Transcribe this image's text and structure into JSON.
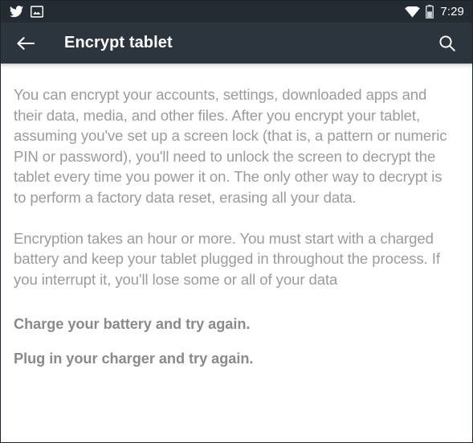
{
  "status_bar": {
    "left_icons": [
      {
        "name": "twitter-icon",
        "label": "Twitter"
      },
      {
        "name": "image-icon",
        "label": "Screenshot captured"
      }
    ],
    "right_icons": [
      {
        "name": "wifi-icon",
        "label": "Wi-Fi"
      },
      {
        "name": "battery-icon",
        "label": "Battery"
      }
    ],
    "clock": "7:29",
    "background_color": "#242b32"
  },
  "app_bar": {
    "back_label": "Navigate up",
    "title": "Encrypt tablet",
    "search_label": "Search",
    "background_color": "#2c353d",
    "title_color": "#ffffff"
  },
  "content": {
    "paragraphs": [
      "You can encrypt your accounts, settings, downloaded apps and their data, media, and other files. After you encrypt your tablet, assuming you've set up a screen lock (that is, a pattern or numeric PIN or password), you'll need to unlock the screen to decrypt the tablet every time you power it on. The only other way to decrypt is to perform a factory data reset, erasing all your data.",
      "Encryption takes an hour or more. You must start with a charged battery and keep your tablet plugged in throughout the process. If you interrupt it, you'll lose some or all of your data"
    ],
    "warnings": [
      "Charge your battery and try again.",
      "Plug in your charger and try again."
    ],
    "body_text_color": "#9b9b9b",
    "warning_text_color": "#8a8a8a",
    "background_color": "#ffffff"
  }
}
